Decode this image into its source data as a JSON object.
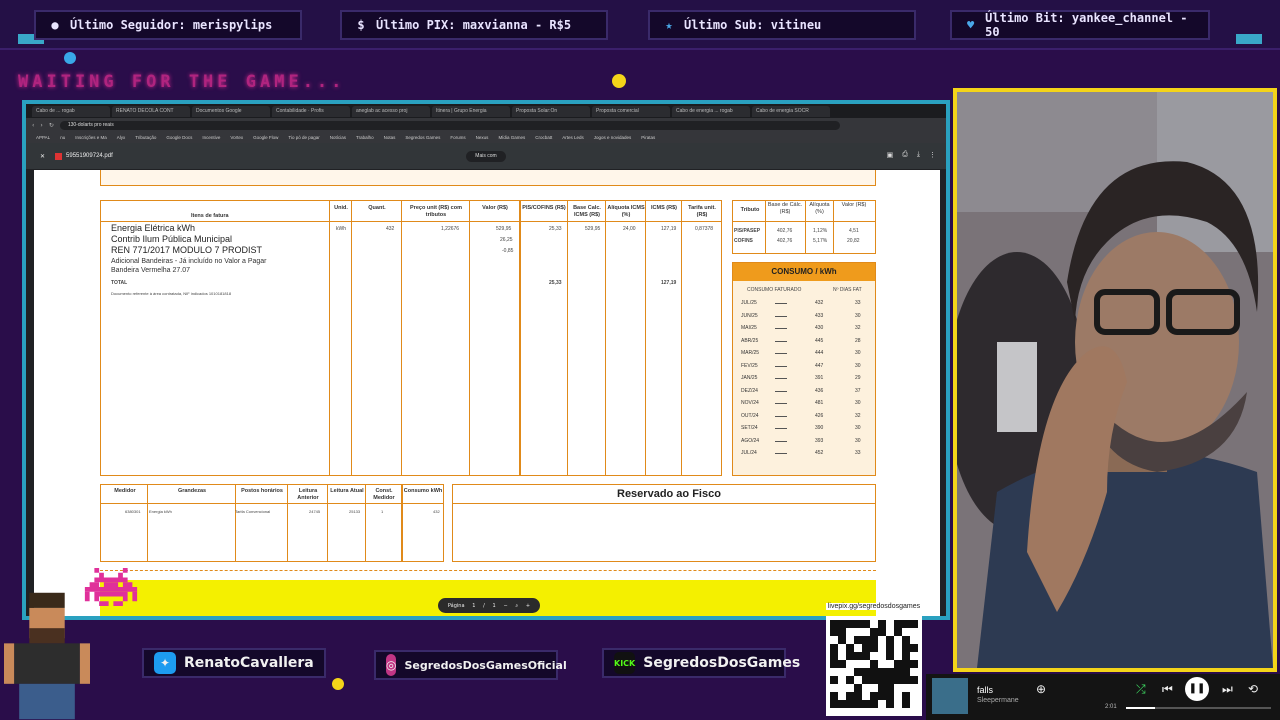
{
  "overlay": {
    "top_bar": {
      "follower": "Último Seguidor: merispylips",
      "pix": "Último PIX: maxvianna - R$5",
      "sub": "Último Sub: vitineu",
      "bit": "Último Bit: yankee_channel - 50"
    },
    "waiting_text": "WAITING FOR THE GAME...",
    "socials": {
      "twitter": "RenatoCavallera",
      "instagram": "SegredosDosGamesOficial",
      "kick_badge": "KICK",
      "kick": "SegredosDosGames"
    },
    "qr_link": "livepix.gg/segredosdosgames",
    "colors": {
      "accent_cyan": "#2aa1c0",
      "cam_border": "#f4d419",
      "waiting": "#b0247f"
    }
  },
  "browser": {
    "tabs": [
      "Cabo de ... rogab",
      "RENATO DECOLA CONT",
      "Documentos Google",
      "Contabilidade · Profis",
      "aneglab ac acesso proj",
      "Itinera | Grupo Energia",
      "Proposta Solar:On",
      "Proposta comercial",
      "Cabo de energia ... rogab",
      "Cabo de energia SOCR"
    ],
    "url": "130-dolarts pro reais",
    "bookmarks": [
      "APPAL",
      "nu",
      "Inscrições e Ma",
      "Alyx",
      "Tributação",
      "Google Docs",
      "Incentive",
      "Vortex",
      "Google Flow",
      "Tio pó de pagar",
      "Notícias",
      "Trabalho",
      "Notas",
      "Segredos Games",
      "Forums",
      "Nexus",
      "Mídia Games",
      "Crocbatt",
      "Artes Leds",
      "Jogos e novidades",
      "Piratas"
    ],
    "pdf_filename": "59551909724.pdf",
    "pdf_zoom": "Mais com",
    "pager": {
      "label": "Página",
      "page": "1",
      "sep": "/",
      "total": "1"
    }
  },
  "invoice": {
    "headers": {
      "itens": "Itens de fatura",
      "unid": "Unid.",
      "quant": "Quant.",
      "preco": "Preço unit (R$) com tributos",
      "valor": "Valor (R$)",
      "pis": "PIS/COFINS (R$)",
      "base": "Base Calc. ICMS (R$)",
      "aliq": "Alíquota ICMS (%)",
      "icms": "ICMS (R$)",
      "tarifa": "Tarifa unit. (R$)"
    },
    "items": [
      "Energia Elétrica kWh",
      "Contrib Ilum Pública Municipal",
      "REN 771/2017 MODULO 7 PRODIST"
    ],
    "items_small": [
      "Adicional Bandeiras - Já incluído no Valor a Pagar",
      "Bandeira Vermelha 27.07"
    ],
    "total_label": "TOTAL",
    "footnote": "Documento referente à área contratada, NIF indicados 1010181818",
    "row1": {
      "unid": "kWh",
      "quant": "432",
      "preco": "1,22676",
      "valor": "529,95",
      "pis": "25,33",
      "base": "529,95",
      "aliq": "24,00",
      "icms": "127,19",
      "tarifa": "0,87378"
    },
    "valor_extra": [
      "26,25",
      "-0,85"
    ],
    "totals": {
      "pis": "25,33",
      "icms": "127,19"
    }
  },
  "tributos": {
    "headers": [
      "Tributo",
      "Base de Cálc. (R$)",
      "Alíquota (%)",
      "Valor (R$)"
    ],
    "rows": [
      {
        "name": "PIS/PASEP",
        "base": "402,76",
        "aliq": "1,12%",
        "valor": "4,51"
      },
      {
        "name": "COFINS",
        "base": "402,76",
        "aliq": "5,17%",
        "valor": "20,82"
      }
    ]
  },
  "consumo": {
    "title": "CONSUMO / kWh",
    "col1": "CONSUMO FATURADO",
    "col2": "Nº DIAS FAT",
    "rows": [
      {
        "mes": "JUL/25",
        "kwh": "432",
        "dias": "33"
      },
      {
        "mes": "JUN/25",
        "kwh": "433",
        "dias": "30"
      },
      {
        "mes": "MAI/25",
        "kwh": "430",
        "dias": "32"
      },
      {
        "mes": "ABR/25",
        "kwh": "445",
        "dias": "28"
      },
      {
        "mes": "MAR/25",
        "kwh": "444",
        "dias": "30"
      },
      {
        "mes": "FEV/25",
        "kwh": "447",
        "dias": "30"
      },
      {
        "mes": "JAN/25",
        "kwh": "391",
        "dias": "29"
      },
      {
        "mes": "DEZ/24",
        "kwh": "436",
        "dias": "37"
      },
      {
        "mes": "NOV/24",
        "kwh": "481",
        "dias": "30"
      },
      {
        "mes": "OUT/24",
        "kwh": "426",
        "dias": "32"
      },
      {
        "mes": "SET/24",
        "kwh": "390",
        "dias": "30"
      },
      {
        "mes": "AGO/24",
        "kwh": "393",
        "dias": "30"
      },
      {
        "mes": "JUL/24",
        "kwh": "452",
        "dias": "33"
      }
    ]
  },
  "medidor": {
    "headers": [
      "Medidor",
      "Grandezas",
      "Postos horários",
      "Leitura Anterior",
      "Leitura Atual",
      "Const. Medidor",
      "Consumo kWh"
    ],
    "row": [
      "6380301",
      "Energia kWh",
      "Tarifa Convencional",
      "24745",
      "25133",
      "1",
      "432"
    ]
  },
  "fisco": "Reservado ao Fisco",
  "player": {
    "title": "falls",
    "artist": "Sleepermane",
    "time": "2:01",
    "progress": 0.2
  }
}
